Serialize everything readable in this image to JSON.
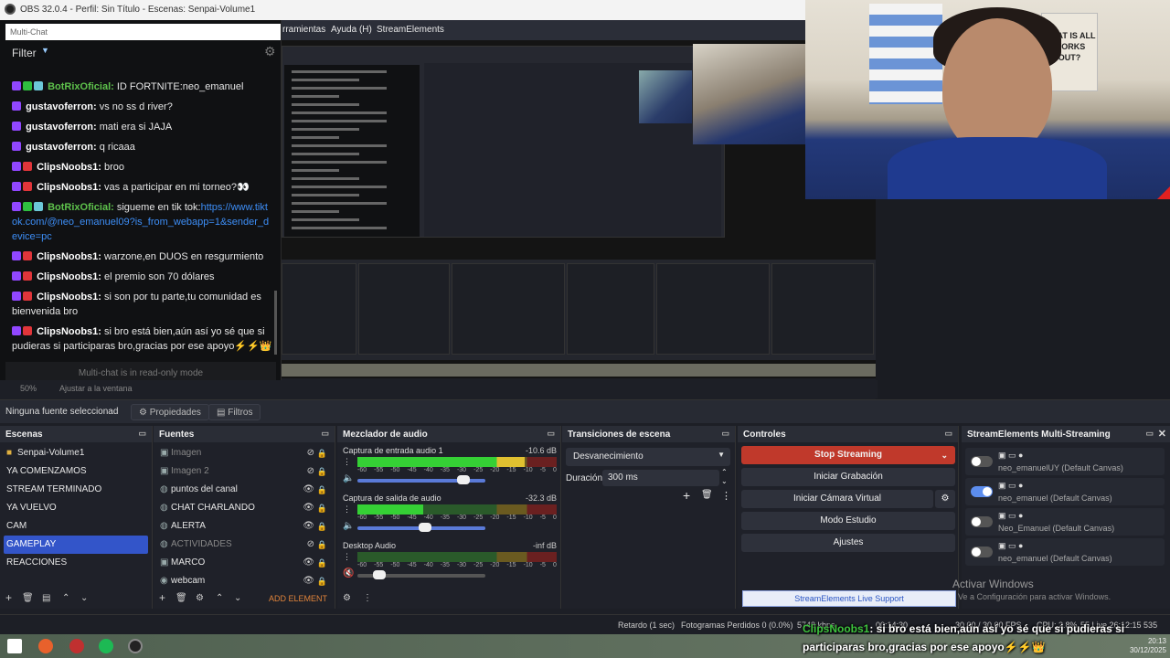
{
  "window": {
    "title": "OBS 32.0.4 - Perfil: Sin Título - Escenas: Senpai-Volume1"
  },
  "menu": {
    "items": [
      "rramientas",
      "Ayuda (H)",
      "StreamElements"
    ]
  },
  "multichat": {
    "tab": "Multi-Chat",
    "filter_label": "Filter",
    "readonly": "Multi-chat is in read-only mode",
    "messages": [
      {
        "user": "BotRixOficial:",
        "text": "ID FORTNITE:neo_emanuel",
        "bot": true
      },
      {
        "user": "gustavoferron:",
        "text": "vs no ss d river?",
        "bot": false
      },
      {
        "user": "gustavoferron:",
        "text": "mati era si JAJA",
        "bot": false
      },
      {
        "user": "gustavoferron:",
        "text": "q ricaaa",
        "bot": false
      },
      {
        "user": "ClipsNoobs1:",
        "text": "broo",
        "bot": false
      },
      {
        "user": "ClipsNoobs1:",
        "text": "vas a participar en mi torneo?👀",
        "bot": false
      }
    ],
    "tiktok_msg": {
      "user": "BotRixOficial:",
      "text": "sigueme en tik tok:",
      "link": "https://www.tiktok.com/@neo_emanuel09?is_from_webapp=1&sender_device=pc"
    },
    "messages2": [
      {
        "user": "ClipsNoobs1:",
        "text": "warzone,en DUOS en resgurmiento"
      },
      {
        "user": "ClipsNoobs1:",
        "text": "el premio son 70 dólares"
      }
    ],
    "wrap_messages": [
      {
        "user": "ClipsNoobs1:",
        "text": "si son por tu parte,tu comunidad es bienvenida bro"
      },
      {
        "user": "ClipsNoobs1:",
        "text": "si bro está bien,aún así yo sé que si pudieras si participaras bro,gracias por ese apoyo⚡⚡👑"
      }
    ]
  },
  "cam": {
    "poster_text": "WHAT IS ALL WORKS OUT?"
  },
  "preview_status": {
    "zoom": "50%",
    "fit": "Ajustar a la ventana"
  },
  "source_bar": {
    "no_source": "Ninguna fuente seleccionad",
    "props": "Propiedades",
    "filters": "Filtros"
  },
  "scenes": {
    "title": "Escenas",
    "items": [
      "Senpai-Volume1",
      "YA COMENZAMOS",
      "STREAM TERMINADO",
      "YA VUELVO",
      "CAM",
      "GAMEPLAY",
      "REACCIONES"
    ],
    "selected": "GAMEPLAY"
  },
  "sources": {
    "title": "Fuentes",
    "items": [
      {
        "label": "Imagen",
        "icon": "image-icon",
        "visible": false
      },
      {
        "label": "Imagen 2",
        "icon": "image-icon",
        "visible": false
      },
      {
        "label": "puntos del canal",
        "icon": "browser-icon",
        "visible": true
      },
      {
        "label": "CHAT CHARLANDO",
        "icon": "browser-icon",
        "visible": true
      },
      {
        "label": "ALERTA",
        "icon": "browser-icon",
        "visible": true
      },
      {
        "label": "ACTIVIDADES",
        "icon": "browser-icon",
        "visible": false
      },
      {
        "label": "MARCO",
        "icon": "image-icon",
        "visible": true
      },
      {
        "label": "webcam",
        "icon": "camera-icon",
        "visible": true
      }
    ],
    "add_element": "ADD ELEMENT"
  },
  "mixer": {
    "title": "Mezclador de audio",
    "scale": [
      "-60",
      "-55",
      "-50",
      "-45",
      "-40",
      "-35",
      "-30",
      "-25",
      "-20",
      "-15",
      "-10",
      "-5",
      "0"
    ],
    "channels": [
      {
        "name": "Captura de entrada audio 1",
        "db": "-10.6 dB",
        "level": 0.84,
        "volume": 0.78
      },
      {
        "name": "Captura de salida de audio",
        "db": "-32.3 dB",
        "level": 0.33,
        "volume": 0.48
      },
      {
        "name": "Desktop Audio",
        "db": "-inf dB",
        "level": 0,
        "volume": 0.12
      }
    ]
  },
  "transitions": {
    "title": "Transiciones de escena",
    "selected": "Desvanecimiento",
    "duration_label": "Duración",
    "duration": "300 ms"
  },
  "controls": {
    "title": "Controles",
    "buttons": [
      "Stop Streaming",
      "Iniciar Grabación",
      "Iniciar Cámara Virtual",
      "Modo Estudio",
      "Ajustes"
    ]
  },
  "se": {
    "title": "StreamElements Multi-Streaming",
    "rows": [
      {
        "name": "neo_emanuelUY (Default Canvas)",
        "on": false
      },
      {
        "name": "neo_emanuel (Default Canvas)",
        "on": true
      },
      {
        "name": "Neo_Emanuel (Default Canvas)",
        "on": false
      },
      {
        "name": "neo_emanuel (Default Canvas)",
        "on": false
      }
    ],
    "live_support": "StreamElements Live Support"
  },
  "watermark": {
    "line1": "Activar Windows",
    "line2": "Ve a Configuración para activar Windows."
  },
  "status": {
    "delay": "Retardo (1 sec)",
    "dropped": "Fotogramas Perdidos 0 (0.0%)",
    "kbps": "5748 kbps",
    "time": "00:14:30",
    "fps": "30.00 / 30.00 FPS",
    "cpu": "CPU: 2.8%",
    "live": "55 Live 26:12:15 535"
  },
  "overlay": {
    "user": "ClipsNoobs1",
    "line1": ": si bro está bien,aún así yo sé que si pudieras si",
    "line2": "participaras bro,gracias por ese apoyo⚡⚡👑"
  },
  "clock": {
    "time": "20:13",
    "date": "30/12/2025"
  }
}
